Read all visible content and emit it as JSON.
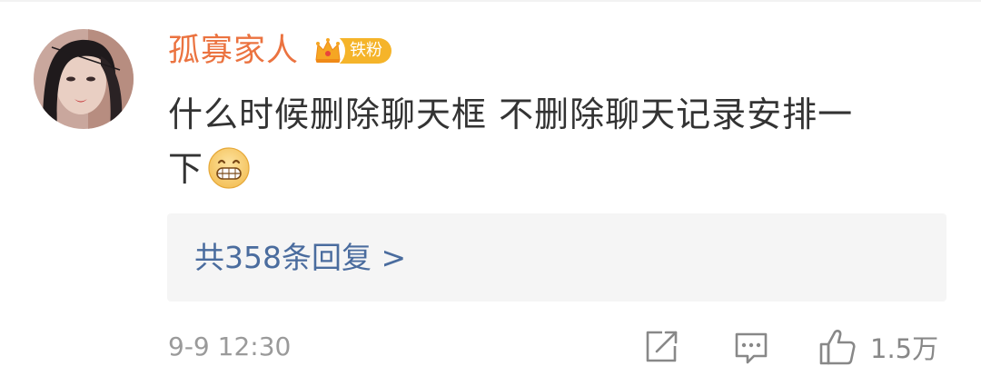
{
  "comment": {
    "username": "孤寡家人",
    "fan_badge": "铁粉",
    "text_line1": "什么时候删除聊天框 不删除聊天记录安排一",
    "text_line2": "下",
    "emoji_icon": "grinning-face-icon",
    "replies_link": "共358条回复 >",
    "timestamp": "9-9 12:30",
    "like_count": "1.5万"
  },
  "colors": {
    "username": "#eb7340",
    "badge": "#f5b42a",
    "link": "#4a6c9e",
    "meta": "#9a9a9a"
  }
}
